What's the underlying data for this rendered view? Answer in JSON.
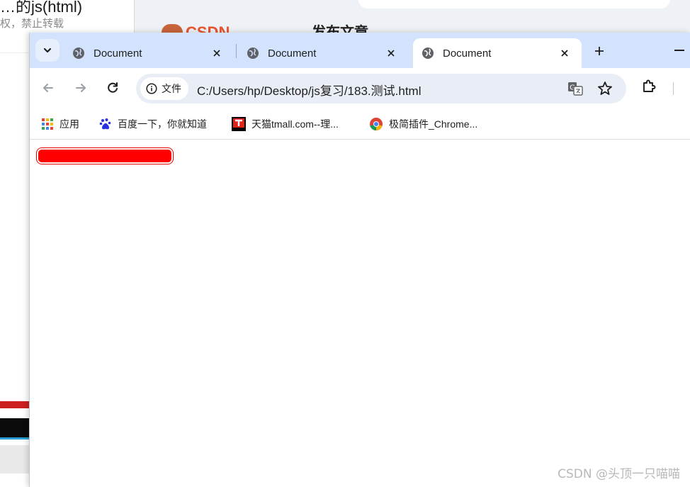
{
  "background": {
    "left_title": "…的js(html)",
    "left_subtitle": "权，禁止转载",
    "csdn_text": "CSDN",
    "publish_text": "发布文章"
  },
  "tabs": [
    {
      "label": "Document",
      "active": false
    },
    {
      "label": "Document",
      "active": false
    },
    {
      "label": "Document",
      "active": true
    }
  ],
  "toolbar": {
    "site_chip_label": "文件",
    "url": "C:/Users/hp/Desktop/js复习/183.测试.html"
  },
  "bookmarks": [
    {
      "label": "应用",
      "icon": "apps-grid-icon"
    },
    {
      "label": "百度一下，你就知道",
      "icon": "baidu-paw-icon"
    },
    {
      "label": "天猫tmall.com--理...",
      "icon": "tmall-icon"
    },
    {
      "label": "极简插件_Chrome...",
      "icon": "chrome-icon"
    }
  ],
  "content": {
    "red_bar_color": "#ff0000"
  },
  "watermark": "CSDN @头顶一只喵喵",
  "colors": {
    "tabstrip": "#d3e3fd",
    "omnibox": "#e9eef6",
    "accent_red": "#ff0000"
  }
}
